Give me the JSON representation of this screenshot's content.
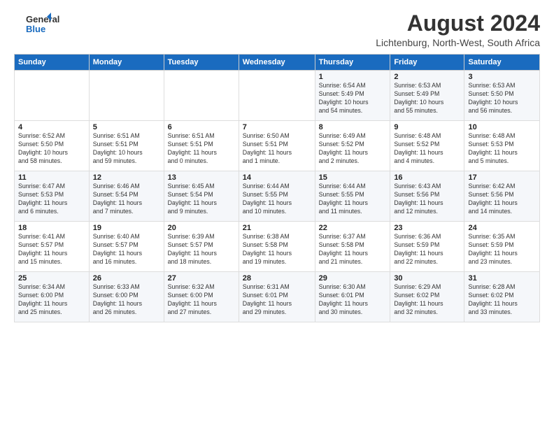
{
  "header": {
    "logo_general": "General",
    "logo_blue": "Blue",
    "month_title": "August 2024",
    "location": "Lichtenburg, North-West, South Africa"
  },
  "days_of_week": [
    "Sunday",
    "Monday",
    "Tuesday",
    "Wednesday",
    "Thursday",
    "Friday",
    "Saturday"
  ],
  "weeks": [
    [
      {
        "day": "",
        "info": ""
      },
      {
        "day": "",
        "info": ""
      },
      {
        "day": "",
        "info": ""
      },
      {
        "day": "",
        "info": ""
      },
      {
        "day": "1",
        "info": "Sunrise: 6:54 AM\nSunset: 5:49 PM\nDaylight: 10 hours\nand 54 minutes."
      },
      {
        "day": "2",
        "info": "Sunrise: 6:53 AM\nSunset: 5:49 PM\nDaylight: 10 hours\nand 55 minutes."
      },
      {
        "day": "3",
        "info": "Sunrise: 6:53 AM\nSunset: 5:50 PM\nDaylight: 10 hours\nand 56 minutes."
      }
    ],
    [
      {
        "day": "4",
        "info": "Sunrise: 6:52 AM\nSunset: 5:50 PM\nDaylight: 10 hours\nand 58 minutes."
      },
      {
        "day": "5",
        "info": "Sunrise: 6:51 AM\nSunset: 5:51 PM\nDaylight: 10 hours\nand 59 minutes."
      },
      {
        "day": "6",
        "info": "Sunrise: 6:51 AM\nSunset: 5:51 PM\nDaylight: 11 hours\nand 0 minutes."
      },
      {
        "day": "7",
        "info": "Sunrise: 6:50 AM\nSunset: 5:51 PM\nDaylight: 11 hours\nand 1 minute."
      },
      {
        "day": "8",
        "info": "Sunrise: 6:49 AM\nSunset: 5:52 PM\nDaylight: 11 hours\nand 2 minutes."
      },
      {
        "day": "9",
        "info": "Sunrise: 6:48 AM\nSunset: 5:52 PM\nDaylight: 11 hours\nand 4 minutes."
      },
      {
        "day": "10",
        "info": "Sunrise: 6:48 AM\nSunset: 5:53 PM\nDaylight: 11 hours\nand 5 minutes."
      }
    ],
    [
      {
        "day": "11",
        "info": "Sunrise: 6:47 AM\nSunset: 5:53 PM\nDaylight: 11 hours\nand 6 minutes."
      },
      {
        "day": "12",
        "info": "Sunrise: 6:46 AM\nSunset: 5:54 PM\nDaylight: 11 hours\nand 7 minutes."
      },
      {
        "day": "13",
        "info": "Sunrise: 6:45 AM\nSunset: 5:54 PM\nDaylight: 11 hours\nand 9 minutes."
      },
      {
        "day": "14",
        "info": "Sunrise: 6:44 AM\nSunset: 5:55 PM\nDaylight: 11 hours\nand 10 minutes."
      },
      {
        "day": "15",
        "info": "Sunrise: 6:44 AM\nSunset: 5:55 PM\nDaylight: 11 hours\nand 11 minutes."
      },
      {
        "day": "16",
        "info": "Sunrise: 6:43 AM\nSunset: 5:56 PM\nDaylight: 11 hours\nand 12 minutes."
      },
      {
        "day": "17",
        "info": "Sunrise: 6:42 AM\nSunset: 5:56 PM\nDaylight: 11 hours\nand 14 minutes."
      }
    ],
    [
      {
        "day": "18",
        "info": "Sunrise: 6:41 AM\nSunset: 5:57 PM\nDaylight: 11 hours\nand 15 minutes."
      },
      {
        "day": "19",
        "info": "Sunrise: 6:40 AM\nSunset: 5:57 PM\nDaylight: 11 hours\nand 16 minutes."
      },
      {
        "day": "20",
        "info": "Sunrise: 6:39 AM\nSunset: 5:57 PM\nDaylight: 11 hours\nand 18 minutes."
      },
      {
        "day": "21",
        "info": "Sunrise: 6:38 AM\nSunset: 5:58 PM\nDaylight: 11 hours\nand 19 minutes."
      },
      {
        "day": "22",
        "info": "Sunrise: 6:37 AM\nSunset: 5:58 PM\nDaylight: 11 hours\nand 21 minutes."
      },
      {
        "day": "23",
        "info": "Sunrise: 6:36 AM\nSunset: 5:59 PM\nDaylight: 11 hours\nand 22 minutes."
      },
      {
        "day": "24",
        "info": "Sunrise: 6:35 AM\nSunset: 5:59 PM\nDaylight: 11 hours\nand 23 minutes."
      }
    ],
    [
      {
        "day": "25",
        "info": "Sunrise: 6:34 AM\nSunset: 6:00 PM\nDaylight: 11 hours\nand 25 minutes."
      },
      {
        "day": "26",
        "info": "Sunrise: 6:33 AM\nSunset: 6:00 PM\nDaylight: 11 hours\nand 26 minutes."
      },
      {
        "day": "27",
        "info": "Sunrise: 6:32 AM\nSunset: 6:00 PM\nDaylight: 11 hours\nand 27 minutes."
      },
      {
        "day": "28",
        "info": "Sunrise: 6:31 AM\nSunset: 6:01 PM\nDaylight: 11 hours\nand 29 minutes."
      },
      {
        "day": "29",
        "info": "Sunrise: 6:30 AM\nSunset: 6:01 PM\nDaylight: 11 hours\nand 30 minutes."
      },
      {
        "day": "30",
        "info": "Sunrise: 6:29 AM\nSunset: 6:02 PM\nDaylight: 11 hours\nand 32 minutes."
      },
      {
        "day": "31",
        "info": "Sunrise: 6:28 AM\nSunset: 6:02 PM\nDaylight: 11 hours\nand 33 minutes."
      }
    ]
  ]
}
